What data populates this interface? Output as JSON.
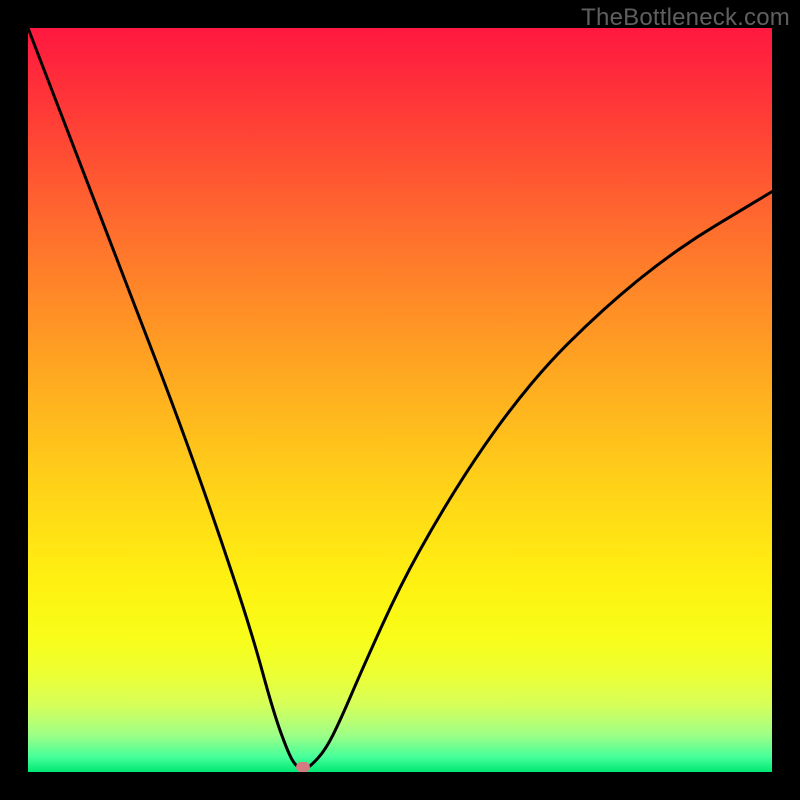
{
  "watermark": "TheBottleneck.com",
  "colors": {
    "frame_bg": "#000000",
    "curve": "#000000",
    "indicator": "#d67a82",
    "gradient_top": "#ff183f",
    "gradient_bottom": "#00e873",
    "watermark": "#5f5f5f"
  },
  "chart_data": {
    "type": "line",
    "title": "",
    "xlabel": "",
    "ylabel": "",
    "xlim": [
      0,
      100
    ],
    "ylim": [
      0,
      100
    ],
    "grid": false,
    "series": [
      {
        "name": "bottleneck-curve",
        "x": [
          0,
          5,
          10,
          15,
          20,
          25,
          30,
          33,
          35,
          36,
          37,
          38,
          40,
          42,
          45,
          50,
          55,
          60,
          65,
          70,
          75,
          80,
          85,
          90,
          95,
          100
        ],
        "values": [
          100,
          87,
          74,
          61,
          48,
          34,
          19,
          8,
          2.5,
          0.8,
          0.3,
          0.8,
          3,
          7,
          14,
          25,
          34,
          42,
          49,
          55,
          60,
          64.5,
          68.5,
          72,
          75,
          78
        ]
      }
    ],
    "annotations": [
      {
        "name": "optimum-indicator",
        "x": 37,
        "y": 0.7
      }
    ]
  }
}
